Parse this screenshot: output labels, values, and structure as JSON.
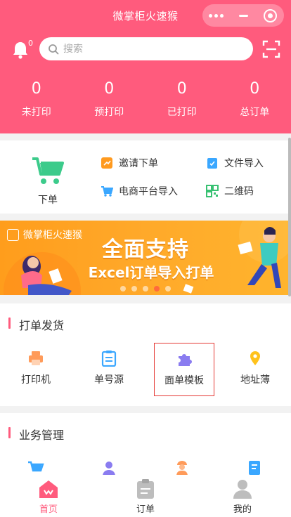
{
  "app": {
    "title": "微掌柜火速猴"
  },
  "header": {
    "bell_badge": "0",
    "search_placeholder": "搜索"
  },
  "stats": [
    {
      "value": "0",
      "label": "未打印"
    },
    {
      "value": "0",
      "label": "预打印"
    },
    {
      "value": "0",
      "label": "已打印"
    },
    {
      "value": "0",
      "label": "总订单"
    }
  ],
  "quick_actions": {
    "main": {
      "label": "下单",
      "icon": "cart-icon"
    },
    "items": [
      {
        "label": "邀请下单",
        "icon": "invite-icon",
        "color": "#ff9a1f"
      },
      {
        "label": "文件导入",
        "icon": "file-import-icon",
        "color": "#3aa7ff"
      },
      {
        "label": "电商平台导入",
        "icon": "ecommerce-cart-icon",
        "color": "#3aa7ff"
      },
      {
        "label": "二维码",
        "icon": "qrcode-icon",
        "color": "#38c172"
      }
    ]
  },
  "banner": {
    "brand": "微掌柜火速猴",
    "headline": "全面支持",
    "subline": "Excel订单导入打单",
    "slides": 5,
    "active_slide": 4
  },
  "sections": {
    "print_ship": {
      "title": "打单发货",
      "items": [
        {
          "label": "打印机",
          "icon": "printer-icon",
          "color": "#ff9b5a"
        },
        {
          "label": "单号源",
          "icon": "clipboard-icon",
          "color": "#3aa7ff"
        },
        {
          "label": "面单模板",
          "icon": "puzzle-icon",
          "color": "#8a7cf0"
        },
        {
          "label": "地址薄",
          "icon": "location-pin-icon",
          "color": "#ffc21c"
        }
      ]
    },
    "business": {
      "title": "业务管理",
      "items": [
        {
          "icon": "cart-icon",
          "color": "#3aa7ff"
        },
        {
          "icon": "user-icon",
          "color": "#8a7cf0"
        },
        {
          "icon": "courier-icon",
          "color": "#ff9b5a"
        },
        {
          "icon": "document-icon",
          "color": "#3aa7ff"
        }
      ]
    }
  },
  "tabbar": [
    {
      "label": "首页",
      "icon": "home-icon",
      "active": true
    },
    {
      "label": "订单",
      "icon": "order-icon",
      "active": false
    },
    {
      "label": "我的",
      "icon": "profile-icon",
      "active": false
    }
  ],
  "colors": {
    "primary": "#ff5b7d",
    "banner": "#ffa92a"
  }
}
